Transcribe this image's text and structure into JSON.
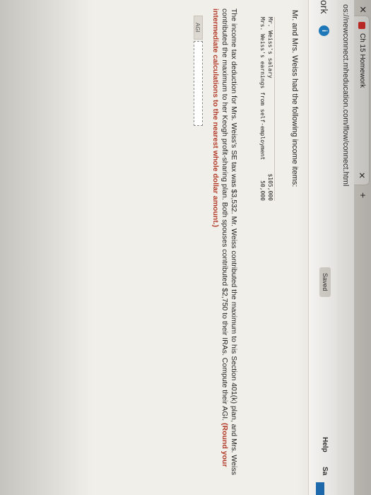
{
  "browser": {
    "tab_close": "✕",
    "tab_title": "Ch 15 Homework",
    "tab_x": "✕",
    "new_tab": "+",
    "url": "os://newconnect.mheducation.com/flow/connect.html"
  },
  "header": {
    "app_name": "ork",
    "info_badge": "i",
    "saved_label": "Saved",
    "help_label": "Help",
    "side_label": "Sa"
  },
  "question": {
    "intro": "Mr. and Mrs. Weiss had the following income items:",
    "income_items": [
      {
        "label": "Mr. Weiss's salary",
        "value": "$105,000"
      },
      {
        "label": "Mrs. Weiss's earnings from self-employment",
        "value": "50,000"
      }
    ],
    "problem_text": "The income tax deduction for Mrs. Weiss's SE tax was $3,532. Mr. Weiss contributed the maximum to his Section 401(k) plan, and Mrs. Weiss contributed the maximum to her Keogh profit-sharing plan. Both spouses contributed $2,750 to their IRAs. Compute their AGI.",
    "instruction": "(Round your intermediate calculations to the nearest whole dollar amount.)",
    "answer_label": "AGI",
    "answer_value": ""
  },
  "colors": {
    "accent": "#1f7fc4",
    "instruction": "#b23b2a",
    "favicon": "#d9302b"
  }
}
